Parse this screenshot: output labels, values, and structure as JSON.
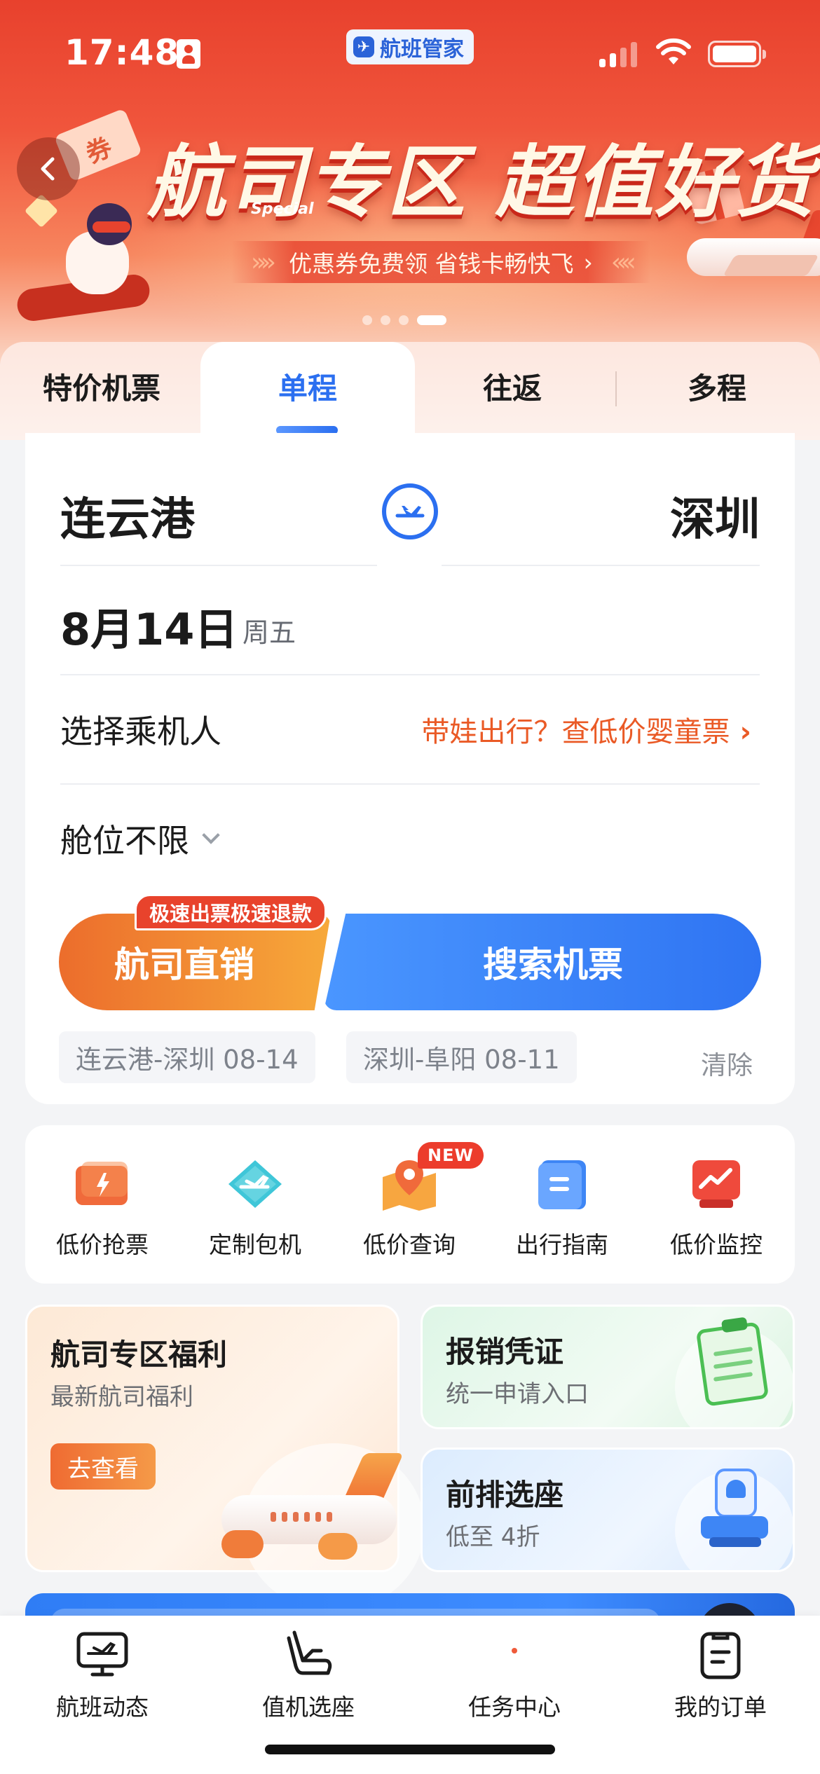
{
  "status_bar": {
    "time": "17:48",
    "app_chip": "航班管家"
  },
  "banner": {
    "title": "航司专区 超值好货",
    "special": "Special",
    "subtitle": "优惠券免费领  省钱卡畅快飞",
    "subtitle_arrow": "›",
    "page_index": 4,
    "page_count": 4,
    "colors": {
      "primary": "#e8412d",
      "light": "#fbd7c6"
    }
  },
  "tabs": [
    {
      "label": "特价机票",
      "active": false
    },
    {
      "label": "单程",
      "active": true
    },
    {
      "label": "往返",
      "active": false
    },
    {
      "label": "多程",
      "active": false
    }
  ],
  "search": {
    "from_city": "连云港",
    "to_city": "深圳",
    "swap_icon": "plane-swap-icon",
    "date": "8月14日",
    "weekday": "周五",
    "passenger_label": "选择乘机人",
    "passenger_link": "带娃出行？查低价婴童票",
    "passenger_link_arrow": "›",
    "cabin": "舱位不限",
    "promo_badge": "极速出票极速退款",
    "airline_button": "航司直销",
    "search_button": "搜索机票",
    "history": [
      "连云港-深圳 08-14",
      "深圳-阜阳 08-11"
    ],
    "clear_label": "清除",
    "colors": {
      "accent": "#2b6ff0",
      "orange": "#ea5a26"
    }
  },
  "quick_menu": {
    "new_badge": "NEW",
    "items": [
      {
        "label": "低价抢票",
        "icon": "ticket-lightning-icon"
      },
      {
        "label": "定制包机",
        "icon": "charter-plane-icon"
      },
      {
        "label": "低价查询",
        "icon": "map-pin-icon"
      },
      {
        "label": "出行指南",
        "icon": "guide-book-icon"
      },
      {
        "label": "低价监控",
        "icon": "price-monitor-icon"
      }
    ]
  },
  "promos": {
    "airline_benefits": {
      "title": "航司专区福利",
      "subtitle": "最新航司福利",
      "button": "去查看"
    },
    "reimbursement": {
      "title": "报销凭证",
      "subtitle": "统一申请入口"
    },
    "front_seat": {
      "title": "前排选座",
      "subtitle": "低至 4折"
    }
  },
  "tabbar": [
    {
      "label": "航班动态",
      "icon": "flight-monitor-icon"
    },
    {
      "label": "值机选座",
      "icon": "seat-icon"
    },
    {
      "label": "任务中心",
      "icon": "task-dot-icon"
    },
    {
      "label": "我的订单",
      "icon": "order-list-icon"
    }
  ]
}
